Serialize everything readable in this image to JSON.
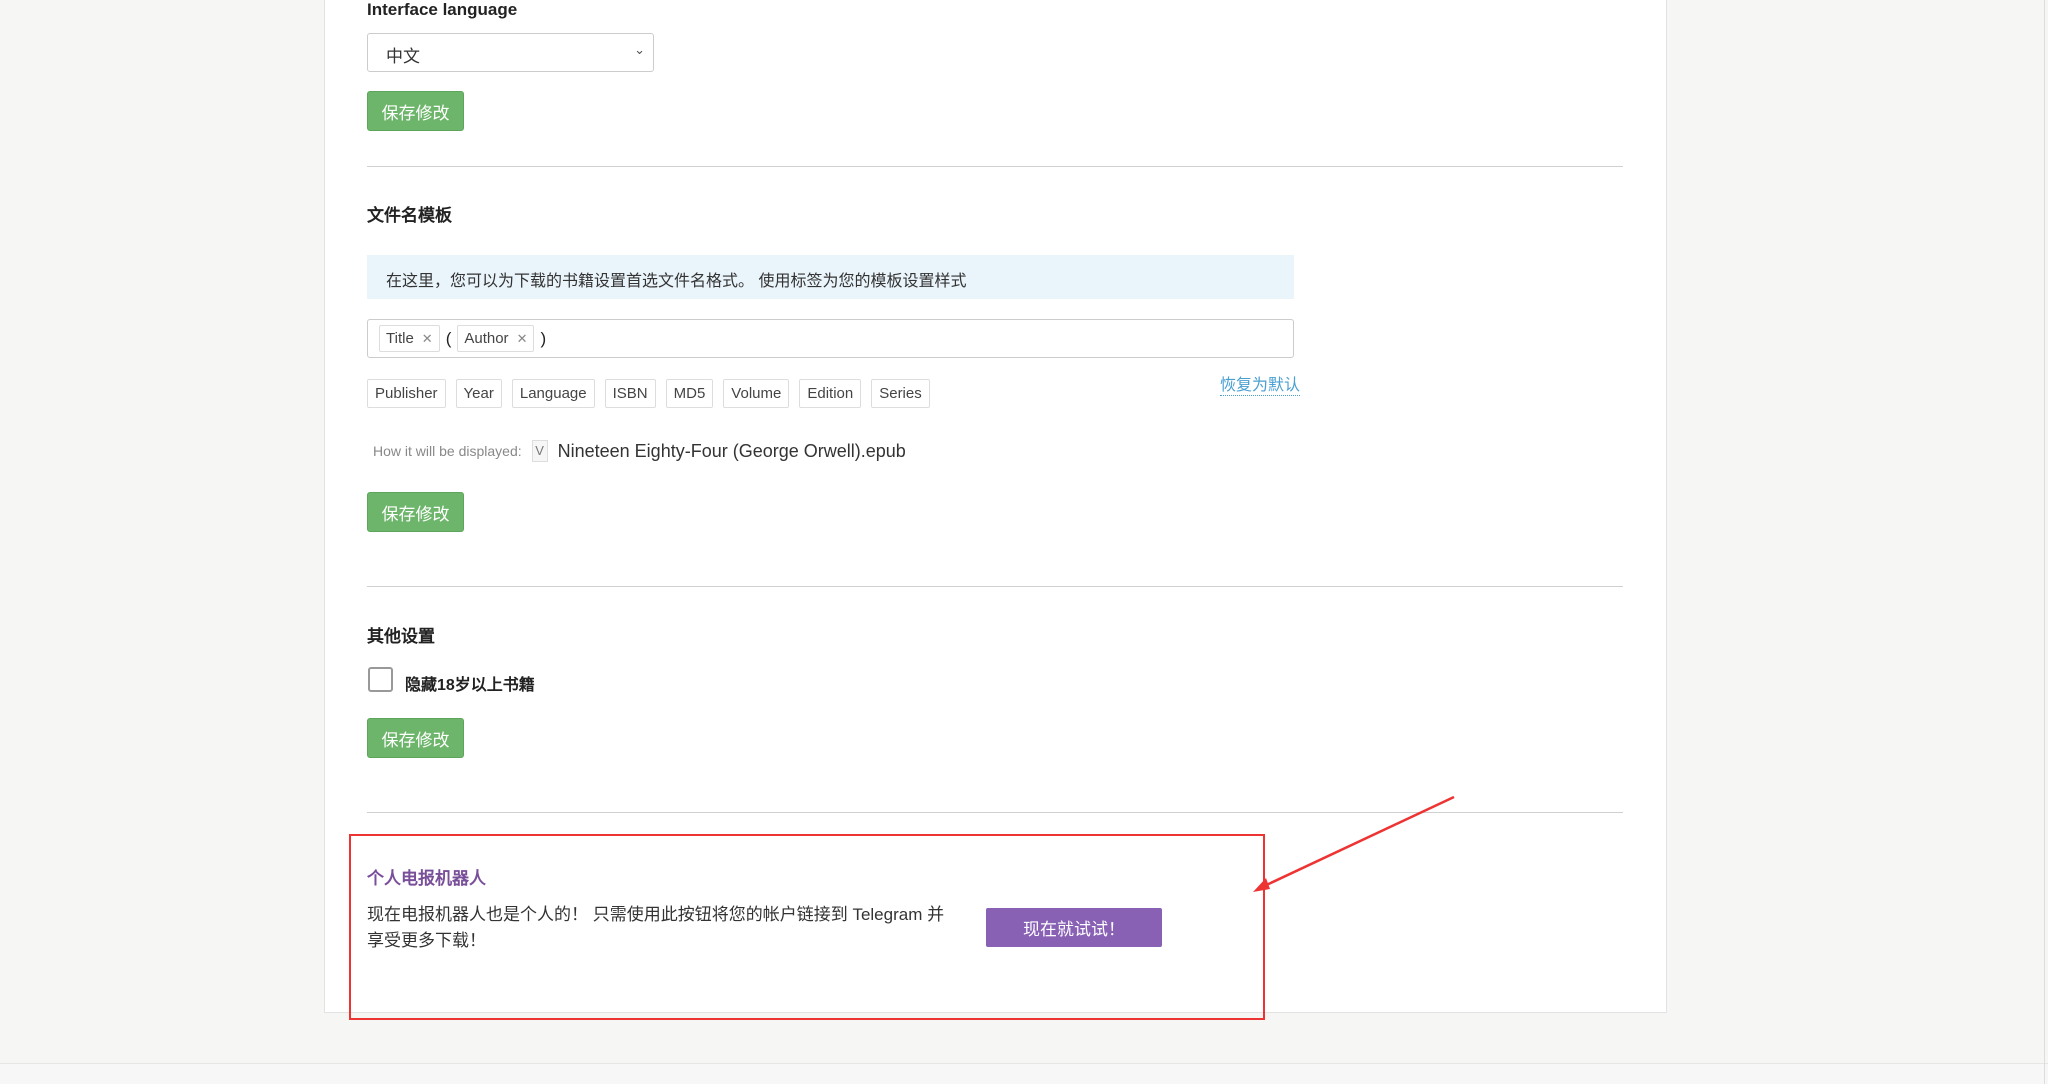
{
  "language_section": {
    "heading": "Interface language",
    "selected": "中文",
    "save_label": "保存修改"
  },
  "filename_section": {
    "heading": "文件名模板",
    "info": "在这里，您可以为下载的书籍设置首选文件名格式。 使用标签为您的模板设置样式",
    "template_tokens": [
      "Title",
      "(",
      "Author",
      ")"
    ],
    "available_tags": [
      "Publisher",
      "Year",
      "Language",
      "ISBN",
      "MD5",
      "Volume",
      "Edition",
      "Series"
    ],
    "reset_label": "恢复为默认",
    "preview_label": "How it will be displayed:",
    "preview_icon_letter": "V",
    "preview_value": "Nineteen Eighty-Four (George Orwell).epub",
    "save_label": "保存修改"
  },
  "other_section": {
    "heading": "其他设置",
    "checkbox_label": "隐藏18岁以上书籍",
    "checked": false,
    "save_label": "保存修改"
  },
  "telegram": {
    "title": "个人电报机器人",
    "text": "现在电报机器人也是个人的！ 只需使用此按钮将您的帐户链接到 Telegram 并享受更多下载！",
    "button": "现在就试试！"
  },
  "colors": {
    "save_button": "#6db56a",
    "telegram_button": "#8860b4",
    "annotation": "#e33333",
    "link": "#4a9fd1"
  }
}
